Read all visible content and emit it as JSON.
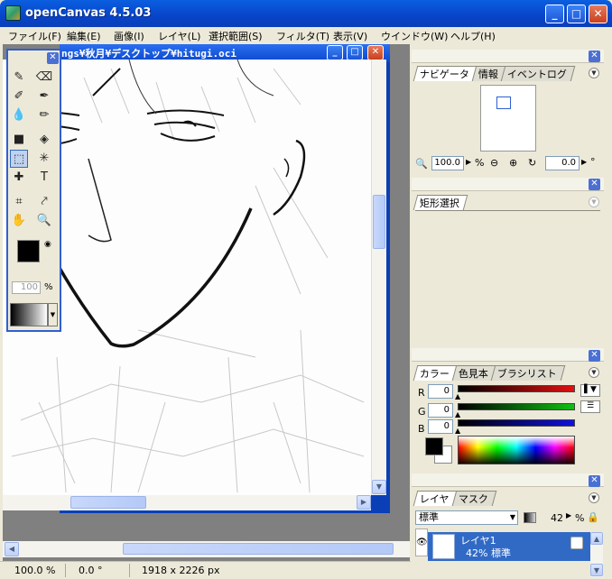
{
  "window": {
    "title": "openCanvas 4.5.03"
  },
  "menu": {
    "items": [
      "ファイル(F)",
      "編集(E)",
      "画像(I)",
      "レイヤ(L)",
      "選択範囲(S)",
      "フィルタ(T)",
      "表示(V)",
      "ウインドウ(W)",
      "ヘルプ(H)"
    ]
  },
  "document": {
    "title": "ngs¥秋月¥デスクトップ¥hitugi.oci"
  },
  "toolbox": {
    "opacity_value": "100",
    "opacity_unit": "%"
  },
  "navigator": {
    "tabs": [
      "ナビゲータ",
      "情報",
      "イベントログ"
    ],
    "zoom_value": "100.0",
    "zoom_unit": "%",
    "rotation_value": "0.0",
    "rotation_unit": "°"
  },
  "selection_panel": {
    "tabs": [
      "矩形選択"
    ]
  },
  "color_panel": {
    "tabs": [
      "カラー",
      "色見本",
      "ブラシリスト"
    ],
    "r_label": "R",
    "r_value": "0",
    "g_label": "G",
    "g_value": "0",
    "b_label": "B",
    "b_value": "0",
    "colors": {
      "r_bar": "#e01010",
      "g_bar": "#10c010",
      "b_bar": "#1010e0"
    }
  },
  "layer_panel": {
    "tabs": [
      "レイヤ",
      "マスク"
    ],
    "blend_mode": "標準",
    "opacity_value": "42",
    "opacity_unit": "%",
    "layer_name": "レイヤ1",
    "layer_info": "42% 標準"
  },
  "statusbar": {
    "zoom": "100.0 %",
    "rotation": "0.0 °",
    "size": "1918 x 2226 px"
  }
}
